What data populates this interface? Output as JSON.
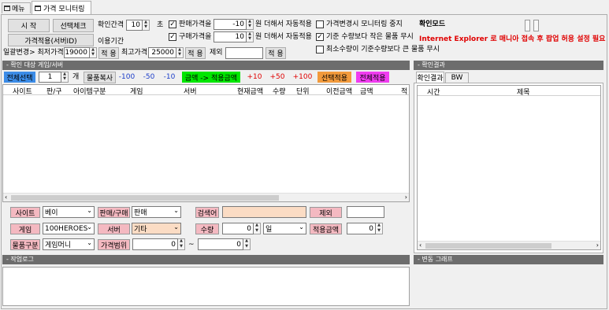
{
  "tabs": [
    {
      "label": "메뉴"
    },
    {
      "label": "가격 모니터링"
    }
  ],
  "toolbar": {
    "start": "시 작",
    "select_check": "선택체크",
    "apply_server_id": "가격적용(서버ID)",
    "interval_label": "확인간격",
    "interval_value": "10",
    "interval_unit": "초",
    "usage_period": "이용기간",
    "sell_price_label": "판매가격을",
    "sell_price_value": "-10",
    "sell_price_suffix": "원 더해서 자동적용",
    "buy_price_label": "구매가격을",
    "buy_price_value": "10",
    "buy_price_suffix": "원 더해서 자동적용",
    "stop_on_change": "가격변경시 모니터링 중지",
    "ignore_below": "기준 수량보다 작은 물품 무시",
    "ignore_above": "최소수량이 기준수량보다 큰 물품 무시",
    "confirm_mode": "확인모드",
    "ie_warning": "Internet Explorer 로 매니아 접속 후 팝업 허용 설정 필요",
    "bulk_change": "일괄변경> 최저가격",
    "min_price": "19000",
    "apply1": "적 용",
    "max_price_label": "최고가격",
    "max_price": "25000",
    "apply2": "적 용",
    "exclude_label": "제외",
    "exclude_value": "",
    "apply3": "적 용"
  },
  "left_section": {
    "title": "- 확인 대상 게임/서버",
    "select_all": "전체선택",
    "count_value": "1",
    "count_unit": "개",
    "copy_items": "물품복사",
    "adjust": [
      "-100",
      "-50",
      "-10"
    ],
    "price_to_apply": "금액 -> 적용금액",
    "adjust_plus": [
      "+10",
      "+50",
      "+100"
    ],
    "apply_selected": "선택적용",
    "apply_all": "전체적용",
    "columns": [
      "사이트",
      "판/구",
      "아이템구분",
      "게임",
      "서버",
      "현재금액",
      "수량",
      "단위",
      "이전금액",
      "금액",
      "적"
    ]
  },
  "right_section": {
    "title": "- 확인결과",
    "tabs": [
      "확인결과",
      "BW"
    ],
    "columns": [
      "시간",
      "제목"
    ]
  },
  "filters": {
    "site_label": "사이트",
    "site_value": "베이",
    "sell_buy_label": "판매/구매",
    "sell_buy_value": "판매",
    "search_label": "검색어",
    "search_value": "",
    "exclude_label": "제외",
    "exclude_value": "",
    "game_label": "게임",
    "game_value": "100HEROES",
    "server_label": "서버",
    "server_value": "기타",
    "qty_label": "수량",
    "qty_value": "0",
    "qty_unit": "일",
    "apply_amount_label": "적용금액",
    "apply_amount_value": "0",
    "item_type_label": "물품구분",
    "item_type_value": "게임머니",
    "price_range_label": "가격범위",
    "price_from": "0",
    "tilde": "~",
    "price_to": "0"
  },
  "log_section": {
    "title": "- 작업로그"
  },
  "graph_section": {
    "title": "- 변동 그래프"
  },
  "colors": {
    "blue_tag": "#3c8ce7",
    "green_tag": "#00e600",
    "orange_tag": "#f29a3c",
    "magenta_tag": "#f03cf0",
    "warn_red": "#e00000",
    "section_gray": "#6d6d6d",
    "label_pink": "#f4b9c1",
    "input_peach": "#fbdcc4"
  }
}
